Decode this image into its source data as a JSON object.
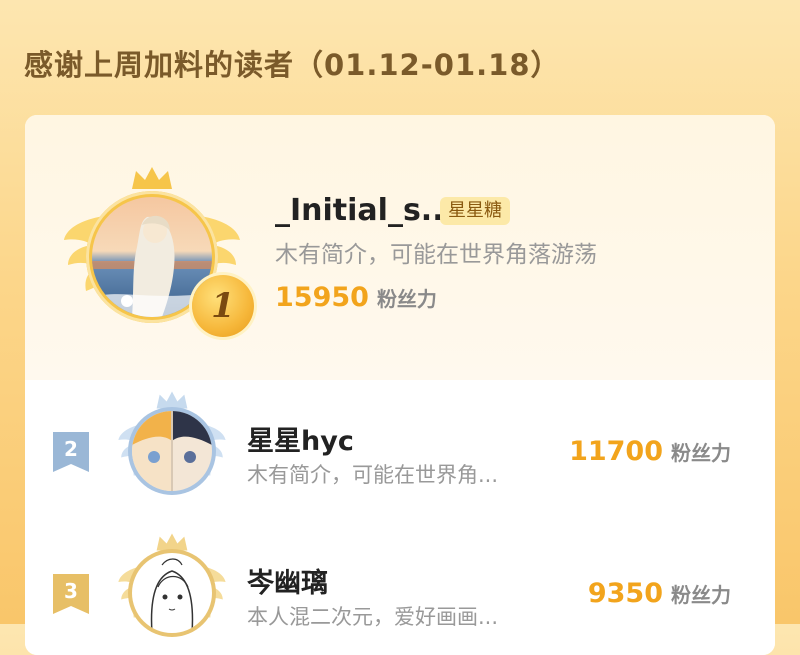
{
  "heading": "感谢上周加料的读者（01.12-01.18）",
  "first": {
    "rank": "1",
    "name": "_Initial_s...",
    "badge": "星星糖",
    "bio": "木有简介，可能在世界角落游荡",
    "score": "15950",
    "score_unit": "粉丝力"
  },
  "others": [
    {
      "rank": "2",
      "name": "星星hyc",
      "bio": "木有简介，可能在世界角...",
      "score": "11700",
      "score_unit": "粉丝力"
    },
    {
      "rank": "3",
      "name": "岑幽璃",
      "bio": "本人混二次元，爱好画画...",
      "score": "9350",
      "score_unit": "粉丝力"
    }
  ],
  "colors": {
    "gold": "#f2a41c",
    "silver": "#9ab7d6",
    "bronze": "#e7bf66"
  }
}
